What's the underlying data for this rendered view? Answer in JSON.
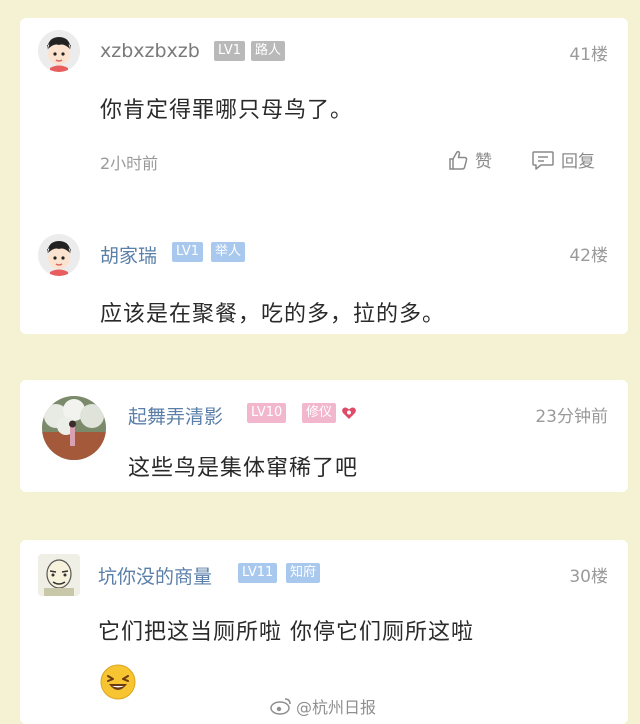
{
  "comments": [
    {
      "user": "xzbxzbxzb",
      "level": "LV1",
      "title": "路人",
      "floor": "41楼",
      "content": "你肯定得罪哪只母鸟了。",
      "time": "2小时前",
      "like_label": "赞",
      "reply_label": "回复"
    },
    {
      "user": "胡家瑞",
      "level": "LV1",
      "title": "举人",
      "floor": "42楼",
      "content": "应该是在聚餐，吃的多，拉的多。"
    },
    {
      "user": "起舞弄清影",
      "level": "LV10",
      "title": "修仪",
      "time": "23分钟前",
      "content": "这些鸟是集体窜稀了吧"
    },
    {
      "user": "坑你没的商量",
      "level": "LV11",
      "title": "知府",
      "floor": "30楼",
      "content": "它们把这当厕所啦 你停它们厕所这啦"
    }
  ],
  "watermark": "@杭州日报",
  "colors": {
    "background": "#f5f2d3",
    "username_gray": "#7a7a7a",
    "username_blue": "#5a7fa8",
    "badge_gray": "#b9b9b9",
    "badge_blue": "#a9c8ee",
    "badge_pink": "#f2b7cd"
  }
}
